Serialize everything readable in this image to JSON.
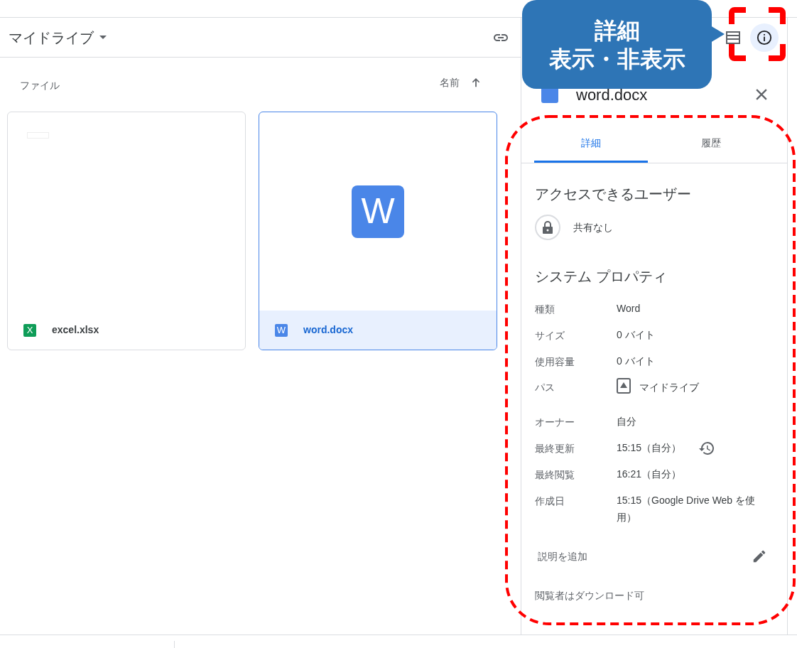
{
  "toolbar": {
    "title": "マイドライブ"
  },
  "callout": {
    "lines": [
      "詳細",
      "表示・非表示"
    ]
  },
  "list_header": {
    "section": "ファイル",
    "sort": "名前"
  },
  "files": [
    {
      "name": "excel.xlsx",
      "kind": "excel",
      "icon_letter": "X",
      "selected": false
    },
    {
      "name": "word.docx",
      "kind": "word",
      "icon_letter": "W",
      "preview_letter": "W",
      "selected": true
    }
  ],
  "details": {
    "title": "word.docx",
    "tabs": [
      {
        "label": "詳細",
        "selected": true
      },
      {
        "label": "履歴",
        "selected": false
      }
    ],
    "access_heading": "アクセスできるユーザー",
    "sharing": "共有なし",
    "properties_heading": "システム プロパティ",
    "properties": [
      {
        "label": "種類",
        "value": "Word",
        "kind": "text"
      },
      {
        "label": "サイズ",
        "value": "0 バイト",
        "kind": "text"
      },
      {
        "label": "使用容量",
        "value": "0 バイト",
        "kind": "text"
      },
      {
        "label": "パス",
        "value": "マイドライブ",
        "kind": "location"
      },
      {
        "label": "オーナー",
        "value": "自分",
        "kind": "text"
      },
      {
        "label": "最終更新",
        "value": "15:15（自分）",
        "kind": "modified"
      },
      {
        "label": "最終閲覧",
        "value": "16:21（自分）",
        "kind": "text"
      },
      {
        "label": "作成日",
        "value": "15:15（Google Drive Web を使用）",
        "kind": "text"
      }
    ],
    "description_placeholder": "説明を追加",
    "download_note": "閲覧者はダウンロード可"
  }
}
